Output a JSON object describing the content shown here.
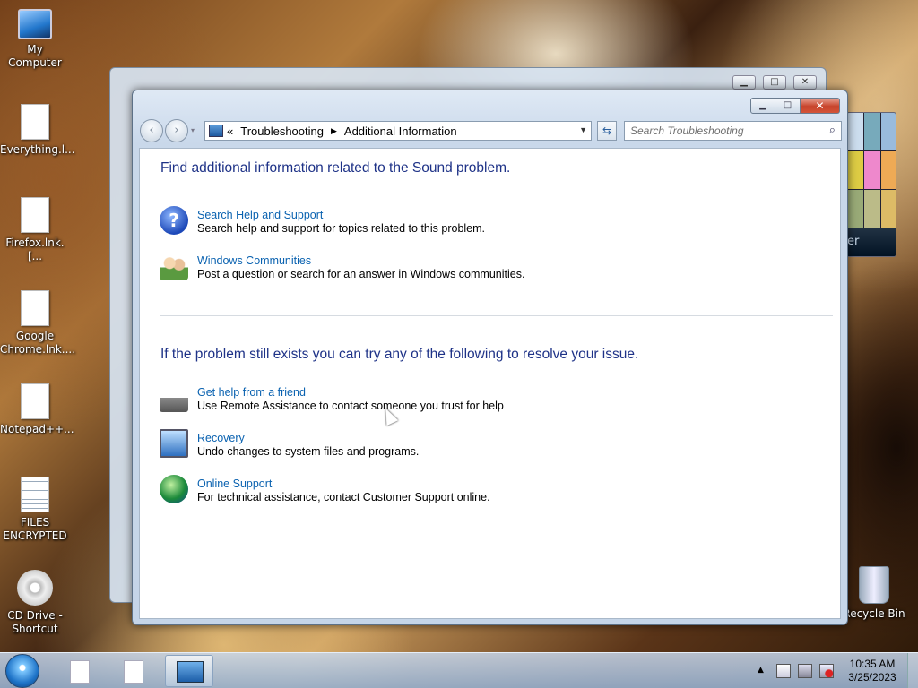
{
  "desktop": {
    "icons": [
      {
        "label": "My Computer"
      },
      {
        "label": "Everything.l..."
      },
      {
        "label": "Firefox.lnk.[..."
      },
      {
        "label": "Google Chrome.lnk...."
      },
      {
        "label": "Notepad++..."
      },
      {
        "label": "FILES ENCRYPTED"
      },
      {
        "label": "CD Drive - Shortcut"
      },
      {
        "label": "Recycle Bin"
      }
    ],
    "gadget_text": "er"
  },
  "window": {
    "nav": {
      "back_glyph": "‹",
      "forward_glyph": "›",
      "dropdown_glyph": "▾"
    },
    "address": {
      "prefix": "«",
      "crumbs": [
        "Troubleshooting",
        "Additional Information"
      ],
      "separator_glyph": "▶",
      "dropdown_glyph": "▼"
    },
    "refresh_glyph": "⇆",
    "search": {
      "placeholder": "Search Troubleshooting",
      "icon_glyph": "⌕"
    },
    "caption": {
      "minimize_glyph": "▁",
      "maximize_glyph": "□",
      "close_glyph": "✕"
    },
    "content": {
      "heading1": "Find additional information related to the Sound problem.",
      "section1": [
        {
          "icon": "help-question-icon",
          "title": "Search Help and Support",
          "desc": "Search help and support for topics related to this problem."
        },
        {
          "icon": "people-icon",
          "title": "Windows Communities",
          "desc": "Post a question or search for an answer in Windows communities."
        }
      ],
      "heading2": "If the problem still exists you can try any of the following to resolve your issue.",
      "section2": [
        {
          "icon": "handshake-icon",
          "title": "Get help from a friend",
          "desc": "Use Remote Assistance to contact someone you trust for help"
        },
        {
          "icon": "recovery-icon",
          "title": "Recovery",
          "desc": "Undo changes to system files and programs."
        },
        {
          "icon": "globe-icon",
          "title": "Online Support",
          "desc": "For technical assistance, contact Customer Support online."
        }
      ]
    }
  },
  "taskbar": {
    "tray_up_glyph": "▲",
    "clock_time": "10:35 AM",
    "clock_date": "3/25/2023"
  }
}
